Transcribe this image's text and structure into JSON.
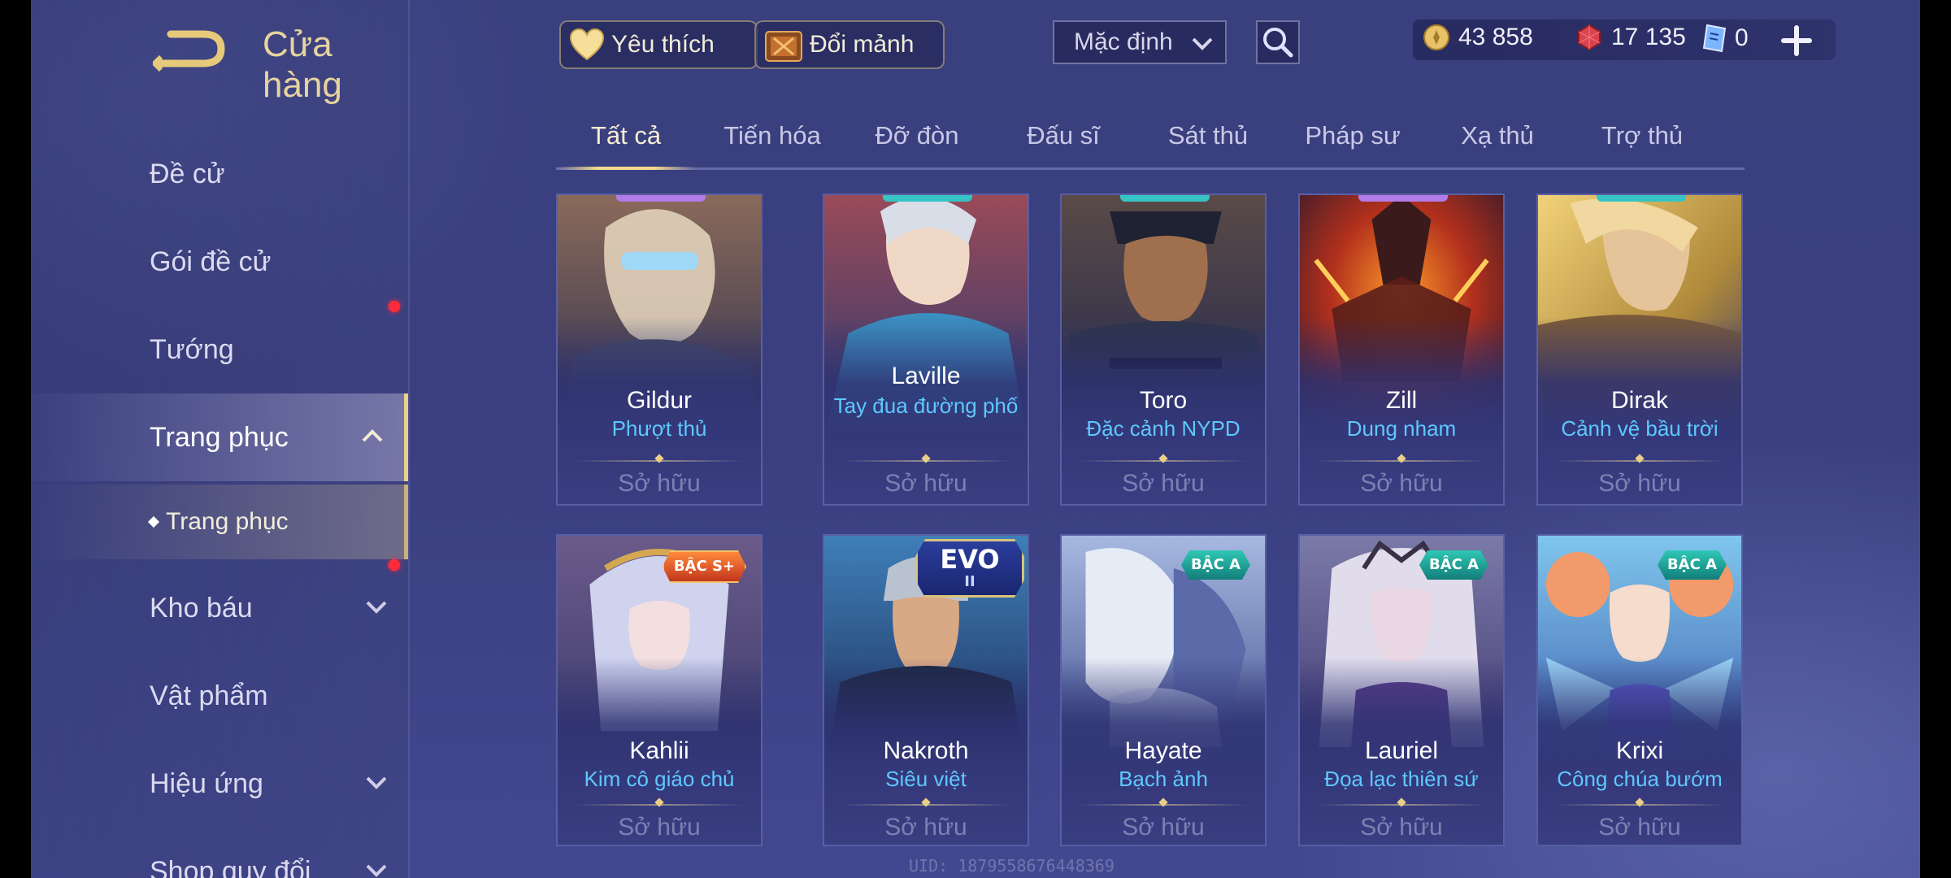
{
  "header": {
    "title": "Cửa hàng",
    "favorite_label": "Yêu thích",
    "shard_label": "Đổi mảnh",
    "sort_selected": "Mặc định",
    "currencies": [
      {
        "name": "gold",
        "value": "43 858"
      },
      {
        "name": "ruby",
        "value": "17 135"
      },
      {
        "name": "voucher",
        "value": "0"
      }
    ]
  },
  "sidebar": {
    "items": [
      {
        "label": "Đề cử"
      },
      {
        "label": "Gói đề cử",
        "notification": true
      },
      {
        "label": "Tướng"
      },
      {
        "label": "Trang phục",
        "expanded": true
      },
      {
        "label": "Kho báu",
        "notification": true
      },
      {
        "label": "Vật phẩm"
      },
      {
        "label": "Hiệu ứng"
      },
      {
        "label": "Shop quy đổi"
      }
    ],
    "sub_item": "Trang phục"
  },
  "tabs": [
    "Tất cả",
    "Tiến hóa",
    "Đỡ đòn",
    "Đấu sĩ",
    "Sát thủ",
    "Pháp sư",
    "Xạ thủ",
    "Trợ thủ"
  ],
  "active_tab": "Tất cả",
  "cards": [
    {
      "hero": "Gildur",
      "skin": "Phượt thủ",
      "status": "Sở hữu"
    },
    {
      "hero": "Laville",
      "skin": "Tay đua đường phố",
      "status": "Sở hữu"
    },
    {
      "hero": "Toro",
      "skin": "Đặc cảnh NYPD",
      "status": "Sở hữu"
    },
    {
      "hero": "Zill",
      "skin": "Dung nham",
      "status": "Sở hữu"
    },
    {
      "hero": "Dirak",
      "skin": "Cảnh vệ bầu trời",
      "status": "Sở hữu"
    },
    {
      "hero": "Kahlii",
      "skin": "Kim cô giáo chủ",
      "status": "Sở hữu",
      "badge": "BẬC S+"
    },
    {
      "hero": "Nakroth",
      "skin": "Siêu việt",
      "status": "Sở hữu",
      "badge": "EVO",
      "badge_level": "II"
    },
    {
      "hero": "Hayate",
      "skin": "Bạch ảnh",
      "status": "Sở hữu",
      "badge": "BẬC A"
    },
    {
      "hero": "Lauriel",
      "skin": "Đọa lạc thiên sứ",
      "status": "Sở hữu",
      "badge": "BẬC A"
    },
    {
      "hero": "Krixi",
      "skin": "Công chúa bướm",
      "status": "Sở hữu",
      "badge": "BẬC A"
    }
  ],
  "footer_uid": "UID: 1879558676448369",
  "colors": {
    "accent": "#e9d08b",
    "skin_text": "#5ec8ff",
    "notification": "#ff2b3a",
    "badge_a": "#2fc7b4",
    "badge_s": "#ff8a3c"
  }
}
